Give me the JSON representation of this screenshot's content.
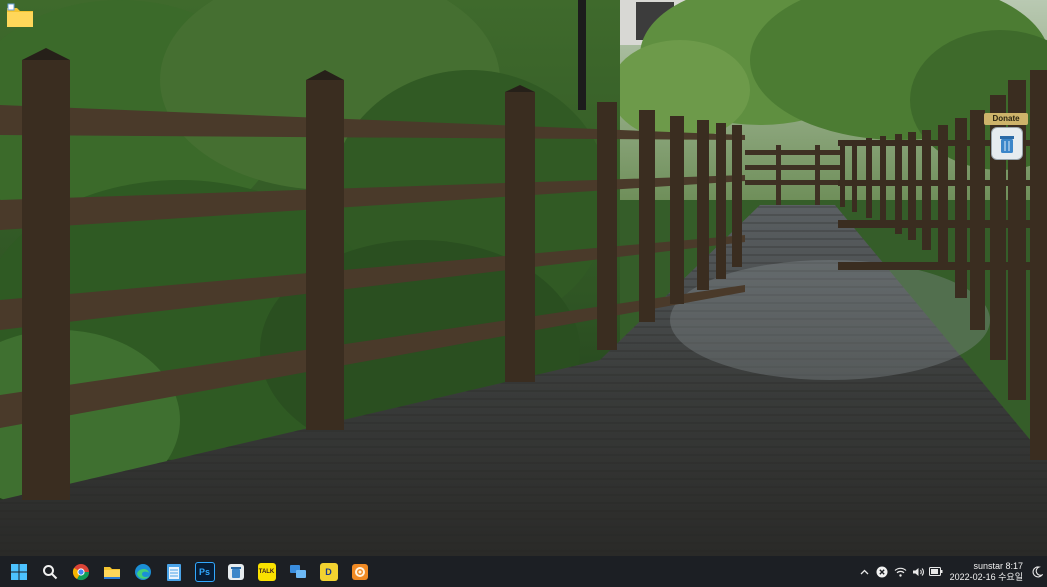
{
  "desktop": {
    "icons": [
      {
        "name": "folder-icon"
      },
      {
        "name": "recycle-bin-icon"
      }
    ],
    "widget": {
      "donate_label": "Donate"
    }
  },
  "taskbar": {
    "apps": [
      {
        "name": "start-button",
        "icon": "windows-logo"
      },
      {
        "name": "search-button",
        "icon": "search-icon"
      },
      {
        "name": "chrome-app",
        "icon": "chrome-icon"
      },
      {
        "name": "file-explorer-app",
        "icon": "folder-icon"
      },
      {
        "name": "edge-app",
        "icon": "edge-icon"
      },
      {
        "name": "notepad-app",
        "icon": "notepad-icon"
      },
      {
        "name": "photoshop-app",
        "icon": "photoshop-icon",
        "label": "Ps"
      },
      {
        "name": "recycle-app",
        "icon": "recycle-icon"
      },
      {
        "name": "kakaotalk-app",
        "icon": "kakaotalk-icon",
        "label": "TALK"
      },
      {
        "name": "network-app",
        "icon": "network-icon"
      },
      {
        "name": "daum-app",
        "icon": "d-icon",
        "label": "D"
      },
      {
        "name": "orange-app",
        "icon": "gear-icon"
      }
    ],
    "tray": {
      "clock_line1": "sunstar 8:17",
      "clock_line2": "2022-02-16 수요일"
    }
  }
}
